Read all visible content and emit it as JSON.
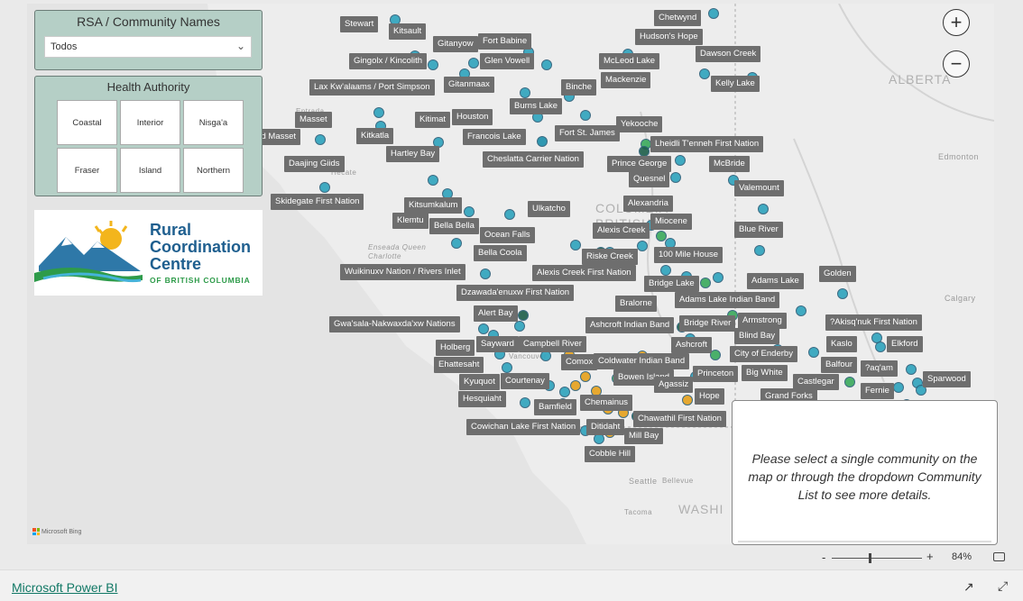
{
  "rsa_filter": {
    "title": "RSA / Community Names",
    "selected": "Todos"
  },
  "health_authority": {
    "title": "Health Authority",
    "options": [
      "Coastal",
      "Interior",
      "Nisga'a",
      "Fraser",
      "Island",
      "Northern"
    ]
  },
  "logo": {
    "line1": "Rural",
    "line2": "Coordination",
    "line3": "Centre",
    "line4": "OF BRITISH COLUMBIA"
  },
  "info_panel": {
    "message": "Please select a single community on the map or through the dropdown Community List to see more details."
  },
  "map": {
    "zoom_in_label": "+",
    "zoom_out_label": "−",
    "attribution": "Microsoft Bing",
    "dot_colors": {
      "coastal": "#2ea3bd",
      "interior": "#3aaa5c",
      "island": "#e6a11c",
      "northern": "#1c8fab",
      "dark": "#1d5f4a"
    },
    "base_labels": [
      "ALBERTA",
      "Edmonton",
      "Calgary",
      "Seattle",
      "Bellevue",
      "Tacoma",
      "WASHI",
      "COLUMBIA",
      "BRITISH",
      "Enseada Queen Charlotte",
      "Vancouver",
      "Entrada",
      "Hecate"
    ],
    "community_labels": [
      "Stewart",
      "Kitsault",
      "Gitanyow",
      "Fort Babine",
      "Gingolx / Kincolith",
      "Glen Vowell",
      "McLeod Lake",
      "Dawson Creek",
      "Chetwynd",
      "Hudson's Hope",
      "Lax Kw'alaams / Port Simpson",
      "Gitanmaax",
      "Binche",
      "Mackenzie",
      "Kelly Lake",
      "Masset",
      "Kitimat",
      "Houston",
      "Burns Lake",
      "Yekooche",
      "Old Masset",
      "Kitkatla",
      "Francois Lake",
      "Fort St. James",
      "Lheidli T'enneh First Nation",
      "Hartley Bay",
      "Cheslatta Carrier Nation",
      "Prince George",
      "McBride",
      "Daajing Giids",
      "Quesnel",
      "Valemount",
      "Skidegate First Nation",
      "Kitsumkalum",
      "Ulkatcho",
      "Alexandria",
      "Klemtu",
      "Bella Bella",
      "Miocene",
      "Alexis Creek",
      "Blue River",
      "Ocean Falls",
      "Riske Creek",
      "Bella Coola",
      "100 Mile House",
      "Wuikinuxv Nation / Rivers Inlet",
      "Alexis Creek First Nation",
      "Golden",
      "Bridge Lake",
      "Adams Lake",
      "Dzawada'enuxw First Nation",
      "Adams Lake Indian Band",
      "Bralorne",
      "Alert Bay",
      "Ashcroft Indian Band",
      "Bridge River",
      "Armstrong",
      "Gwa'sala-Nakwaxda'xw Nations",
      "?Akisq'nuk First Nation",
      "Blind Bay",
      "Sayward",
      "Campbell River",
      "Ashcroft",
      "Elkford",
      "Holberg",
      "City of Enderby",
      "Kaslo",
      "Ehattesaht",
      "Comox",
      "Coldwater Indian Band",
      "Balfour",
      "?aq'am",
      "Big White",
      "Princeton",
      "Kyuquot",
      "Courtenay",
      "Bowen Island",
      "Sparwood",
      "Agassiz",
      "Castlegar",
      "Fernie",
      "Hesquiaht",
      "Hope",
      "Grand Forks",
      "Bamfield",
      "Chemainus",
      "Chawathil First Nation",
      "Cowichan Lake First Nation",
      "Ditidaht",
      "Mill Bay",
      "Cobble Hill"
    ]
  },
  "zoom_bar": {
    "minus": "-",
    "plus": "+",
    "percent": "84%"
  },
  "footer": {
    "link": "Microsoft Power BI"
  }
}
